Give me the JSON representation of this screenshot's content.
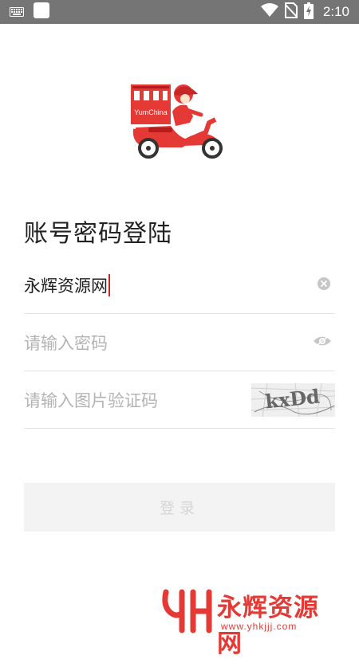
{
  "status_bar": {
    "time": "2:10",
    "icons": [
      "keyboard-icon",
      "notification-square-icon",
      "wifi-icon",
      "no-sim-icon",
      "battery-charging-icon"
    ]
  },
  "logo": {
    "brand_text": "YumChina",
    "icon": "delivery-scooter-logo",
    "color": "#e53935"
  },
  "page_title": "账号密码登陆",
  "form": {
    "username": {
      "value": "永辉资源网",
      "trailing_icon": "clear-icon"
    },
    "password": {
      "placeholder": "请输入密码",
      "trailing_icon": "eye-icon"
    },
    "captcha": {
      "placeholder": "请输入图片验证码",
      "image_text": "kxDd"
    }
  },
  "login_button": {
    "label": "登录"
  },
  "watermark": {
    "logo": "YH",
    "text": "永辉资源网",
    "url": "www.yhkjjj.com",
    "color": "#e53935"
  }
}
